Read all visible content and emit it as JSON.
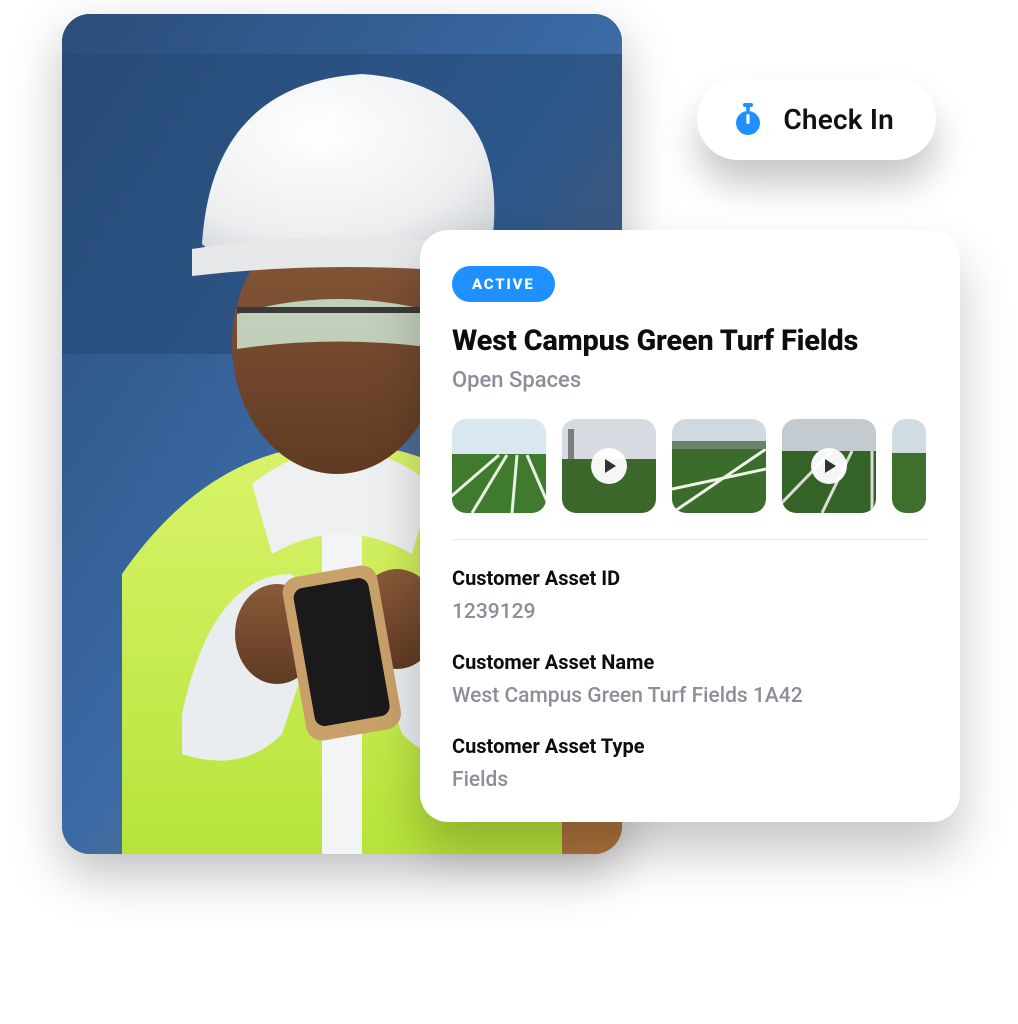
{
  "checkin": {
    "label": "Check In"
  },
  "card": {
    "status": "ACTIVE",
    "title": "West Campus Green Turf Fields",
    "subtitle": "Open Spaces",
    "fields": {
      "asset_id_label": "Customer Asset ID",
      "asset_id_value": "1239129",
      "asset_name_label": "Customer Asset Name",
      "asset_name_value": "West Campus Green Turf Fields 1A42",
      "asset_type_label": "Customer Asset Type",
      "asset_type_value": "Fields"
    },
    "media": [
      {
        "type": "image"
      },
      {
        "type": "video"
      },
      {
        "type": "image"
      },
      {
        "type": "video"
      },
      {
        "type": "image"
      }
    ]
  },
  "colors": {
    "accent": "#1e90ff",
    "muted": "#8a8f98"
  }
}
